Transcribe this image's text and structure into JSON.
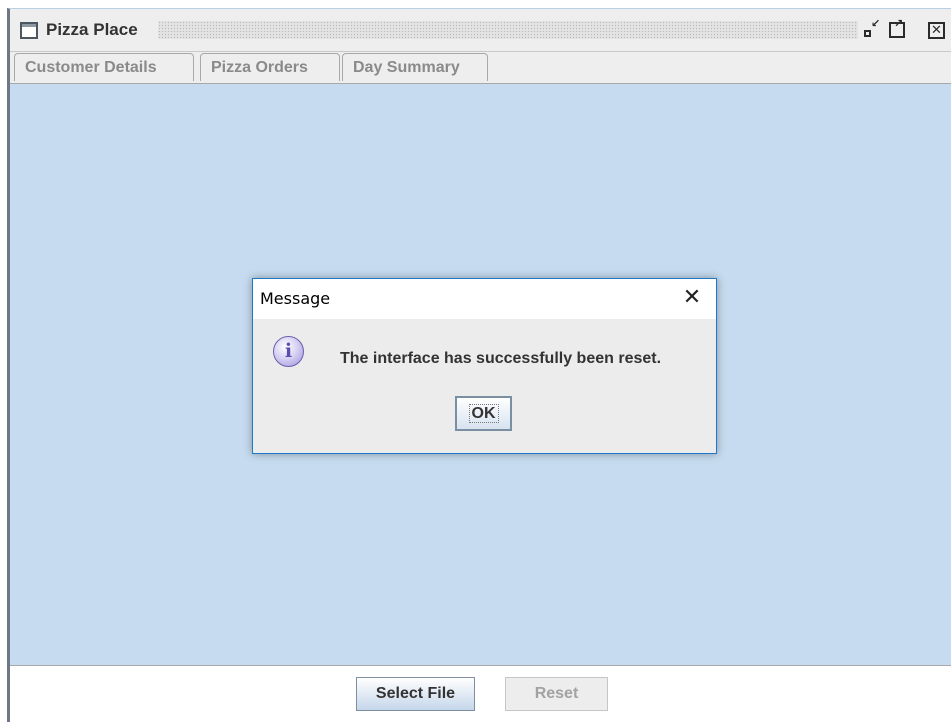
{
  "window": {
    "title": "Pizza Place",
    "icons": {
      "app": "window-icon",
      "minimize": "iconify-icon",
      "maximize": "maximize-icon",
      "close": "close-icon"
    },
    "close_glyph": "✕"
  },
  "tabs": [
    {
      "label": "Customer Details",
      "selected": false
    },
    {
      "label": "Pizza Orders",
      "selected": false
    },
    {
      "label": "Day Summary",
      "selected": false
    }
  ],
  "footer": {
    "select_file_label": "Select File",
    "reset_label": "Reset",
    "reset_enabled": false
  },
  "dialog": {
    "title": "Message",
    "close_glyph": "✕",
    "icon": "information-icon",
    "icon_glyph": "i",
    "message": "The interface has successfully been reset.",
    "ok_label": "OK"
  },
  "colors": {
    "content_background": "#c6dbef",
    "dialog_border": "#1e78c8",
    "button_gradient_end": "#c5d6ea"
  }
}
